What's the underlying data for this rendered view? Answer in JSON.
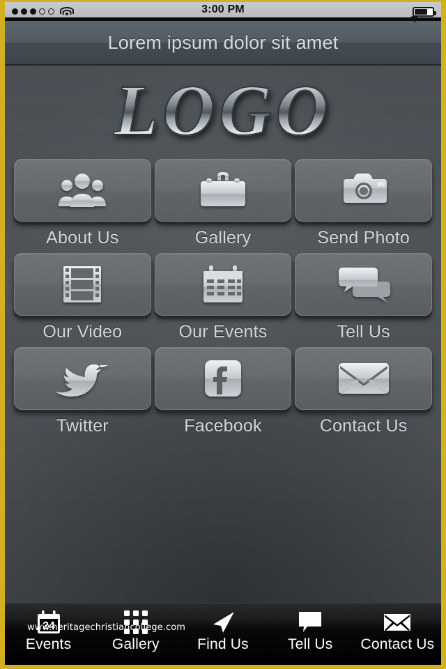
{
  "status_bar": {
    "signal": {
      "icon": "signal-dots",
      "total": 5,
      "filled": 3
    },
    "wifi_icon": "wifi-icon",
    "time": "3:00 PM",
    "location_icon": "location-arrow-icon",
    "battery": {
      "icon": "battery-icon",
      "level_percent": 70
    }
  },
  "header": {
    "title": "Lorem ipsum dolor sit amet"
  },
  "logo": {
    "text": "LOGO"
  },
  "grid": {
    "items": [
      {
        "label": "About Us",
        "icon": "people-group-icon"
      },
      {
        "label": "Gallery",
        "icon": "briefcase-icon"
      },
      {
        "label": "Send Photo",
        "icon": "camera-icon"
      },
      {
        "label": "Our Video",
        "icon": "film-strip-icon"
      },
      {
        "label": "Our Events",
        "icon": "calendar-icon"
      },
      {
        "label": "Tell Us",
        "icon": "speech-bubbles-icon"
      },
      {
        "label": "Twitter",
        "icon": "twitter-bird-icon"
      },
      {
        "label": "Facebook",
        "icon": "facebook-f-icon"
      },
      {
        "label": "Contact Us",
        "icon": "envelope-icon"
      }
    ]
  },
  "tab_bar": {
    "items": [
      {
        "label": "Events",
        "icon": "calendar-24-icon",
        "badge": "24"
      },
      {
        "label": "Gallery",
        "icon": "grid-dots-icon"
      },
      {
        "label": "Find Us",
        "icon": "navigation-arrow-icon"
      },
      {
        "label": "Tell Us",
        "icon": "speech-bubble-icon"
      },
      {
        "label": "Contact Us",
        "icon": "envelope-icon"
      }
    ]
  },
  "watermark": {
    "text": "www.heritagechristiancollege.com"
  },
  "colors": {
    "frame": "#d4af1e",
    "background": "#4e5357",
    "tile": "#686c6e",
    "title_bar": "#535b63",
    "label_text": "#d2d6d9",
    "tab_bar": "#000000"
  }
}
